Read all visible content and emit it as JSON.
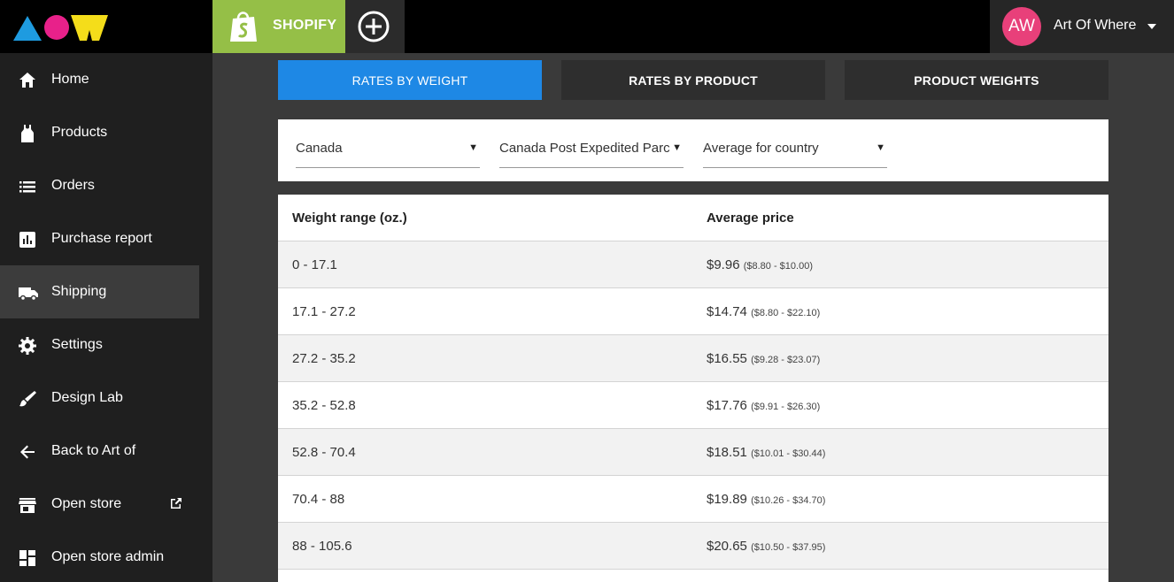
{
  "app": {
    "logo_name": "aow-logo",
    "brand_colors": {
      "triangle": "#1e9be0",
      "circle": "#e8218a",
      "w": "#f4dd1a"
    }
  },
  "topbar": {
    "platform_tab": "SHOPIFY",
    "platform_color": "#95bf47",
    "add_icon": "plus-circle-icon",
    "user": {
      "initials": "AW",
      "name": "Art Of Where",
      "avatar_color": "#e8407a"
    }
  },
  "sidebar": {
    "items": [
      {
        "label": "Home",
        "icon": "home-icon",
        "active": false
      },
      {
        "label": "Products",
        "icon": "tank-top-icon",
        "active": false
      },
      {
        "label": "Orders",
        "icon": "list-icon",
        "active": false
      },
      {
        "label": "Purchase report",
        "icon": "bar-chart-icon",
        "active": false
      },
      {
        "label": "Shipping",
        "icon": "truck-icon",
        "active": true
      },
      {
        "label": "Settings",
        "icon": "gear-icon",
        "active": false
      },
      {
        "label": "Design Lab",
        "icon": "brush-icon",
        "active": false
      },
      {
        "label": "Back to Art of",
        "icon": "arrow-left-icon",
        "active": false
      },
      {
        "label": "Open store",
        "icon": "store-icon",
        "active": false,
        "external": true
      },
      {
        "label": "Open store admin",
        "icon": "dashboard-icon",
        "active": false
      }
    ]
  },
  "tabs": {
    "rates_by_weight": "RATES BY WEIGHT",
    "rates_by_product": "RATES BY PRODUCT",
    "product_weights": "PRODUCT WEIGHTS",
    "active_color": "#1e88e5"
  },
  "filters": {
    "country": "Canada",
    "carrier": "Canada Post Expedited Parcel",
    "region": "Average for country"
  },
  "table": {
    "headers": {
      "range": "Weight range (oz.)",
      "price": "Average price"
    },
    "rows": [
      {
        "range": "0 - 17.1",
        "price": "$9.96",
        "price_range": "($8.80 - $10.00)"
      },
      {
        "range": "17.1 - 27.2",
        "price": "$14.74",
        "price_range": "($8.80 - $22.10)"
      },
      {
        "range": "27.2 - 35.2",
        "price": "$16.55",
        "price_range": "($9.28 - $23.07)"
      },
      {
        "range": "35.2 - 52.8",
        "price": "$17.76",
        "price_range": "($9.91 - $26.30)"
      },
      {
        "range": "52.8 - 70.4",
        "price": "$18.51",
        "price_range": "($10.01 - $30.44)"
      },
      {
        "range": "70.4 - 88",
        "price": "$19.89",
        "price_range": "($10.26 - $34.70)"
      },
      {
        "range": "88 - 105.6",
        "price": "$20.65",
        "price_range": "($10.50 - $37.95)"
      }
    ]
  }
}
